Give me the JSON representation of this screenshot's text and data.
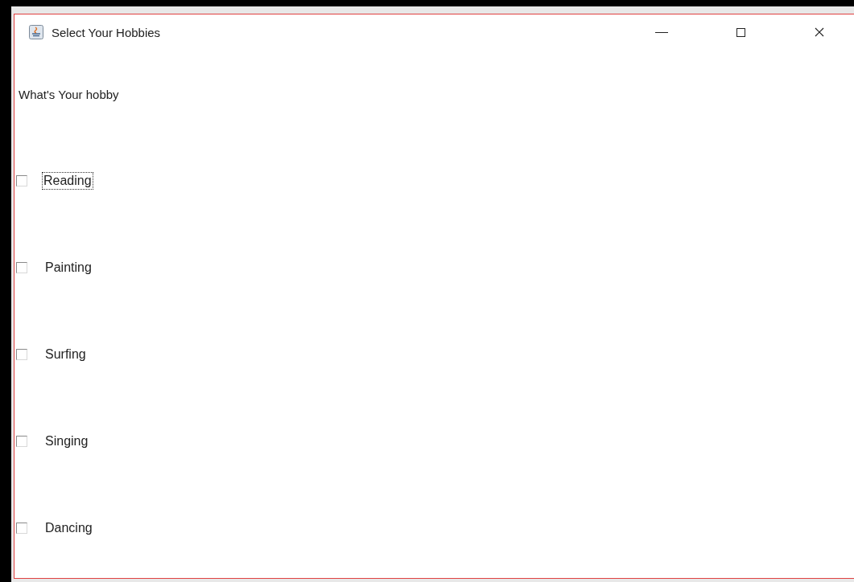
{
  "window": {
    "title": "Select Your Hobbies"
  },
  "prompt": "What's Your hobby",
  "hobbies": [
    {
      "label": "Reading",
      "checked": false,
      "focused": true
    },
    {
      "label": "Painting",
      "checked": false,
      "focused": false
    },
    {
      "label": "Surfing",
      "checked": false,
      "focused": false
    },
    {
      "label": "Singing",
      "checked": false,
      "focused": false
    },
    {
      "label": "Dancing",
      "checked": false,
      "focused": false
    }
  ]
}
